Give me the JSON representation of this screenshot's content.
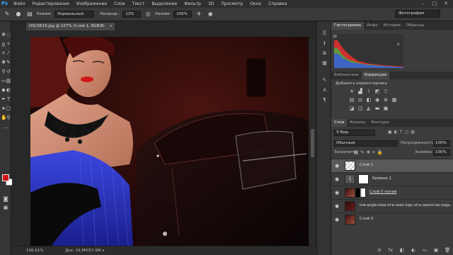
{
  "app": {
    "logo": "Ps"
  },
  "menubar": {
    "items": [
      "Файл",
      "Редактирование",
      "Изображение",
      "Слои",
      "Текст",
      "Выделение",
      "Фильтр",
      "3D",
      "Просмотр",
      "Окно",
      "Справка"
    ],
    "win_controls": [
      "–",
      "□",
      "✕"
    ]
  },
  "options": {
    "mode_label": "Режим:",
    "mode_value": "Нормальный",
    "opacity_label": "Непрозр.:",
    "opacity_value": "13%",
    "flow_label": "Нажим:",
    "flow_value": "100%",
    "workspace": "Фотография"
  },
  "document": {
    "tab_title": "DSC6619.jpg @ 107% (Слой 1, RGB/8)",
    "close": "×",
    "zoom": "106,61%",
    "doc_info": "Док: 19,8M/57,9M"
  },
  "colors": {
    "foreground": "#d11515",
    "background": "#ffffff",
    "accent": "#31a8ff"
  },
  "top_panel": {
    "tabs": [
      "Гистограмма",
      "Инфо",
      "История",
      "Образцы"
    ],
    "active_tab": 0,
    "warning_icon": "⚠"
  },
  "adjust_panel": {
    "tabs": [
      "Библиотеки",
      "Коррекция"
    ],
    "active_tab": 1,
    "title": "Добавить корректировку"
  },
  "layers_panel": {
    "tabs": [
      "Слои",
      "Каналы",
      "Контуры"
    ],
    "active_tab": 0,
    "filter_value": "Вид",
    "blend_value": "Обычные",
    "opacity_label": "Непрозрачность:",
    "opacity_value": "100%",
    "lock_label": "Закрепить:",
    "fill_label": "Заливка:",
    "fill_value": "100%",
    "layers": [
      {
        "name": "Слой 1",
        "visible": true,
        "selected": true
      },
      {
        "name": "Кривые 1",
        "visible": true,
        "selected": false
      },
      {
        "name": "Слой 0 копия",
        "visible": true,
        "selected": false
      },
      {
        "name": "low-angle-view-of-a-neon-sign-of-a-casino-las-vega...",
        "visible": true,
        "selected": false
      },
      {
        "name": "Слой 0",
        "visible": true,
        "selected": false
      }
    ],
    "bottom_icons": [
      "⊖",
      "fx",
      "◧",
      "◐",
      "▭",
      "▣",
      "🗑"
    ]
  }
}
